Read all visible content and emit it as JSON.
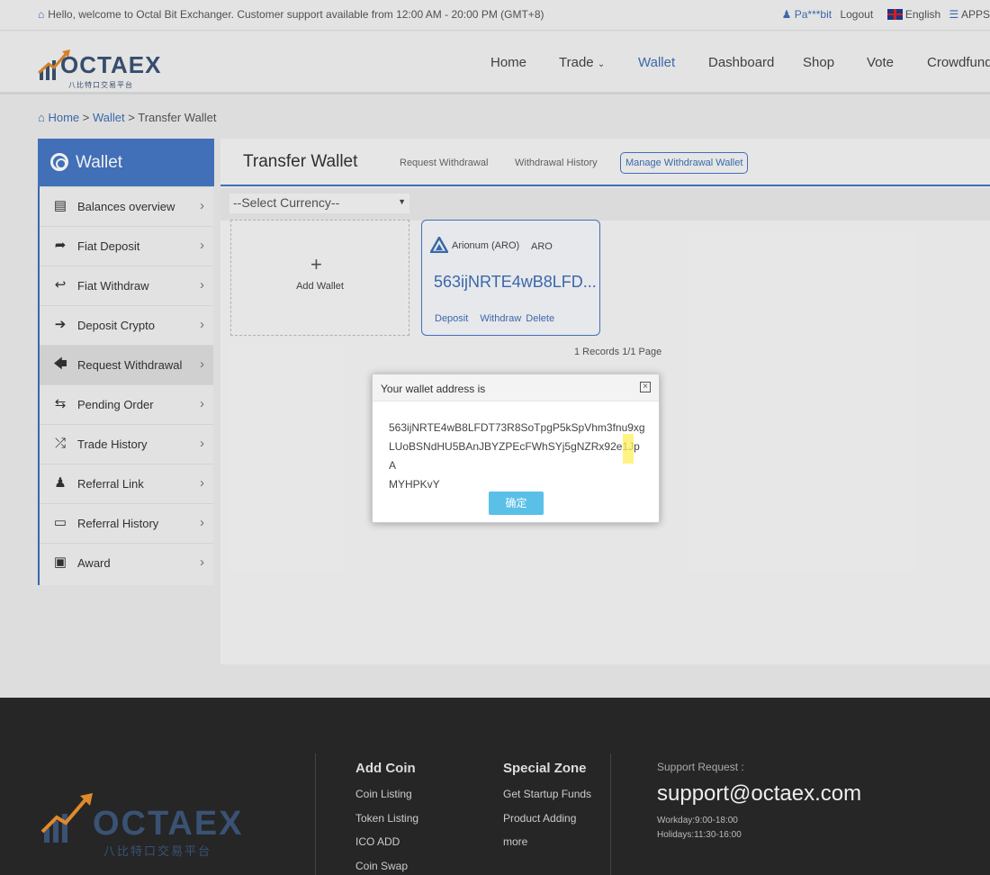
{
  "topbar": {
    "welcome": "Hello, welcome to Octal Bit Exchanger. Customer support available from 12:00 AM - 20:00 PM (GMT+8)",
    "user": "Pa***bit",
    "logout": "Logout",
    "language": "English",
    "apps": "APPS"
  },
  "logo": {
    "word": "OCTAEX",
    "sub": "八比特口交易平台"
  },
  "nav": {
    "items": [
      "Home",
      "Trade",
      "Wallet",
      "Dashboard",
      "Shop",
      "Vote",
      "Crowdfund"
    ],
    "active": "Wallet"
  },
  "breadcrumb": {
    "home": "Home",
    "wallet": "Wallet",
    "current": "Transfer Wallet",
    "sep": ">"
  },
  "sidebar": {
    "title": "Wallet",
    "items": [
      {
        "label": "Balances overview",
        "icon": "server-icon"
      },
      {
        "label": "Fiat Deposit",
        "icon": "share-icon"
      },
      {
        "label": "Fiat Withdraw",
        "icon": "reply-icon"
      },
      {
        "label": "Deposit Crypto",
        "icon": "arrow-right-icon"
      },
      {
        "label": "Request Withdrawal",
        "icon": "arrow-left-icon"
      },
      {
        "label": "Pending Order",
        "icon": "exchange-icon"
      },
      {
        "label": "Trade History",
        "icon": "shuffle-icon"
      },
      {
        "label": "Referral Link",
        "icon": "users-icon"
      },
      {
        "label": "Referral History",
        "icon": "credit-card-icon"
      },
      {
        "label": "Award",
        "icon": "archive-icon"
      }
    ],
    "selected": "Request Withdrawal"
  },
  "main": {
    "title": "Transfer Wallet",
    "tabs": [
      "Request Withdrawal",
      "Withdrawal History",
      "Manage Withdrawal Wallet"
    ],
    "select_placeholder": "--Select Currency--",
    "add_wallet": "Add Wallet",
    "wallet": {
      "coin_name": "Arionum (ARO)",
      "symbol": "ARO",
      "address_short": "563ijNRTE4wB8LFD...",
      "actions": [
        "Deposit",
        "Withdraw",
        "Delete"
      ]
    },
    "records": "1 Records 1/1 Page"
  },
  "modal": {
    "title": "Your wallet address is",
    "address_line1": "563ijNRTE4wB8LFDT73R8SoTpgP5kSpVhm3fnu9xg",
    "address_line2": "LUoBSNdHU5BAnJBYZPEcFWhSYj5gNZRx92e1JpA",
    "address_line3": "MYHPKvY",
    "ok": "确定"
  },
  "footer": {
    "logo_word": "OCTAEX",
    "logo_sub": "八比特口交易平台",
    "add_coin": {
      "title": "Add Coin",
      "links": [
        "Coin Listing",
        "Token Listing",
        "ICO ADD",
        "Coin Swap"
      ]
    },
    "special_zone": {
      "title": "Special Zone",
      "links": [
        "Get Startup Funds",
        "Product Adding",
        "more"
      ]
    },
    "support": {
      "label": "Support Request :",
      "email": "support@octaex.com",
      "workday": "Workday:9:00-18:00",
      "holidays": "Holidays:11:30-16:00"
    }
  },
  "colors": {
    "accent": "#4676c4",
    "button": "#5bc0e8",
    "footer": "#262626"
  }
}
